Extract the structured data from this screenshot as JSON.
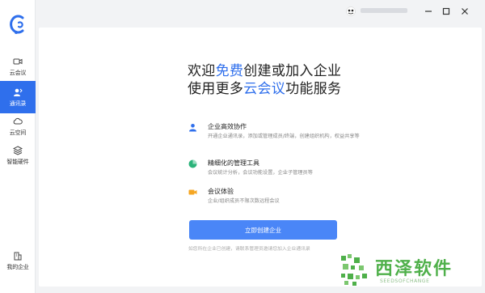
{
  "sidebar": {
    "items": [
      {
        "label": "云会议",
        "icon": "video-camera-icon"
      },
      {
        "label": "通讯录",
        "icon": "contacts-icon"
      },
      {
        "label": "云空间",
        "icon": "cloud-icon"
      },
      {
        "label": "智能硬件",
        "icon": "hardware-icon"
      }
    ],
    "bottom_item": {
      "label": "我的企业",
      "icon": "building-icon"
    },
    "active_index": 1
  },
  "main": {
    "headline_line1_a": "欢迎",
    "headline_line1_hl": "免费",
    "headline_line1_b": "创建或加入企业",
    "headline_line2_a": "使用更多",
    "headline_line2_hl": "云会议",
    "headline_line2_b": "功能服务",
    "features": [
      {
        "title": "企业高效协作",
        "desc": "开通企业通讯录，添加或管理成员/终端，创建组织机构，权益共享等",
        "icon": "person-icon"
      },
      {
        "title": "精细化的管理工具",
        "desc": "会议统计分析，会议功能设置，企业子管理员等",
        "icon": "pie-chart-icon"
      },
      {
        "title": "会议体验",
        "desc": "企业/组织成员不限次数远程会议",
        "icon": "camera-icon"
      }
    ],
    "cta_label": "立即创建企业",
    "hint": "如您所在企业已创建，请联系管理员邀请您加入企业通讯录"
  },
  "watermark": {
    "text": "西泽软件",
    "sub": "SEEDSOFCHANGE"
  },
  "colors": {
    "accent": "#2f6fec",
    "button": "#4a86f7",
    "orange": "#f5a623",
    "green": "#2bb37a"
  }
}
